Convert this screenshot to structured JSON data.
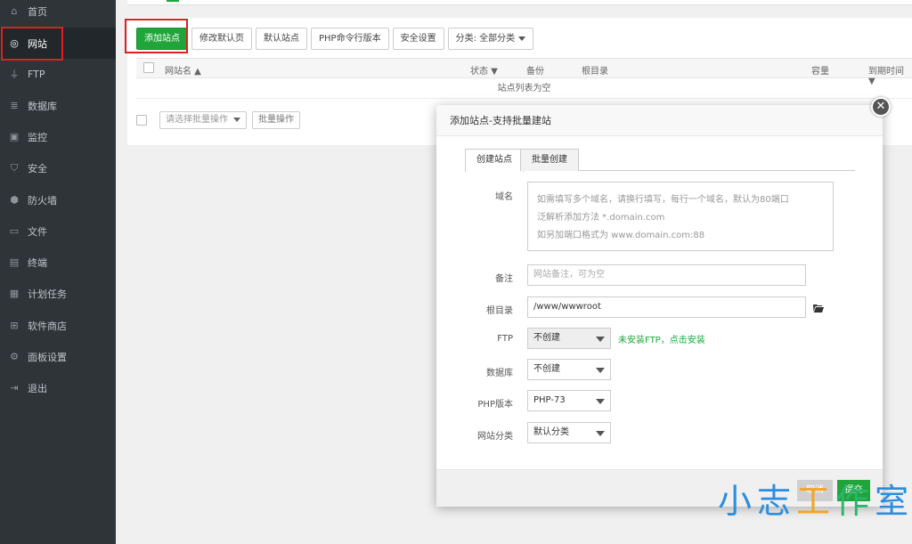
{
  "sidebar": {
    "items": [
      {
        "label": "首页",
        "icon": "home-icon",
        "glyph": "⌂"
      },
      {
        "label": "网站",
        "icon": "globe-icon",
        "glyph": "◎"
      },
      {
        "label": "FTP",
        "icon": "ftp-icon",
        "glyph": "⏚"
      },
      {
        "label": "数据库",
        "icon": "database-icon",
        "glyph": "≣"
      },
      {
        "label": "监控",
        "icon": "monitor-icon",
        "glyph": "▣"
      },
      {
        "label": "安全",
        "icon": "shield-icon",
        "glyph": "⛉"
      },
      {
        "label": "防火墙",
        "icon": "firewall-icon",
        "glyph": "⬢"
      },
      {
        "label": "文件",
        "icon": "folder-icon",
        "glyph": "▭"
      },
      {
        "label": "终端",
        "icon": "terminal-icon",
        "glyph": "▤"
      },
      {
        "label": "计划任务",
        "icon": "calendar-icon",
        "glyph": "▦"
      },
      {
        "label": "软件商店",
        "icon": "apps-icon",
        "glyph": "⊞"
      },
      {
        "label": "面板设置",
        "icon": "gear-icon",
        "glyph": "⚙"
      },
      {
        "label": "退出",
        "icon": "logout-icon",
        "glyph": "⇥"
      }
    ],
    "active_index": 1
  },
  "toolbar": {
    "add_site": "添加站点",
    "modify_default": "修改默认页",
    "default_site": "默认站点",
    "php_cli": "PHP命令行版本",
    "security": "安全设置",
    "category": "分类: 全部分类"
  },
  "table": {
    "headers": {
      "name": "网站名 ▲",
      "status": "状态 ▼",
      "backup": "备份",
      "root": "根目录",
      "capacity": "容量",
      "expire": "到期时间 ▼"
    },
    "empty": "站点列表为空"
  },
  "bulk": {
    "select_placeholder": "请选择批量操作",
    "action": "批量操作"
  },
  "modal": {
    "title": "添加站点-支持批量建站",
    "close": "✕",
    "tabs": [
      "创建站点",
      "批量创建"
    ],
    "domain_label": "域名",
    "domain_hint_1": "如需填写多个域名，请换行填写，每行一个域名，默认为80端口",
    "domain_hint_2": "泛解析添加方法 *.domain.com",
    "domain_hint_3": "如另加端口格式为 www.domain.com:88",
    "note_label": "备注",
    "note_placeholder": "网站备注，可为空",
    "root_label": "根目录",
    "root_value": "/www/wwwroot",
    "ftp_label": "FTP",
    "ftp_value": "不创建",
    "ftp_hint": "未安装FTP，点击安装",
    "db_label": "数据库",
    "db_value": "不创建",
    "php_label": "PHP版本",
    "php_value": "PHP-73",
    "category_label": "网站分类",
    "category_value": "默认分类",
    "cancel": "取消",
    "submit": "提交"
  },
  "watermark": {
    "c1": "小",
    "c2": "志",
    "c3": "工",
    "c4": "作",
    "c5": "室"
  },
  "colors": {
    "sidebar_bg": "#2f3438",
    "accent_green": "#20a53a",
    "highlight_red": "#e02020"
  }
}
